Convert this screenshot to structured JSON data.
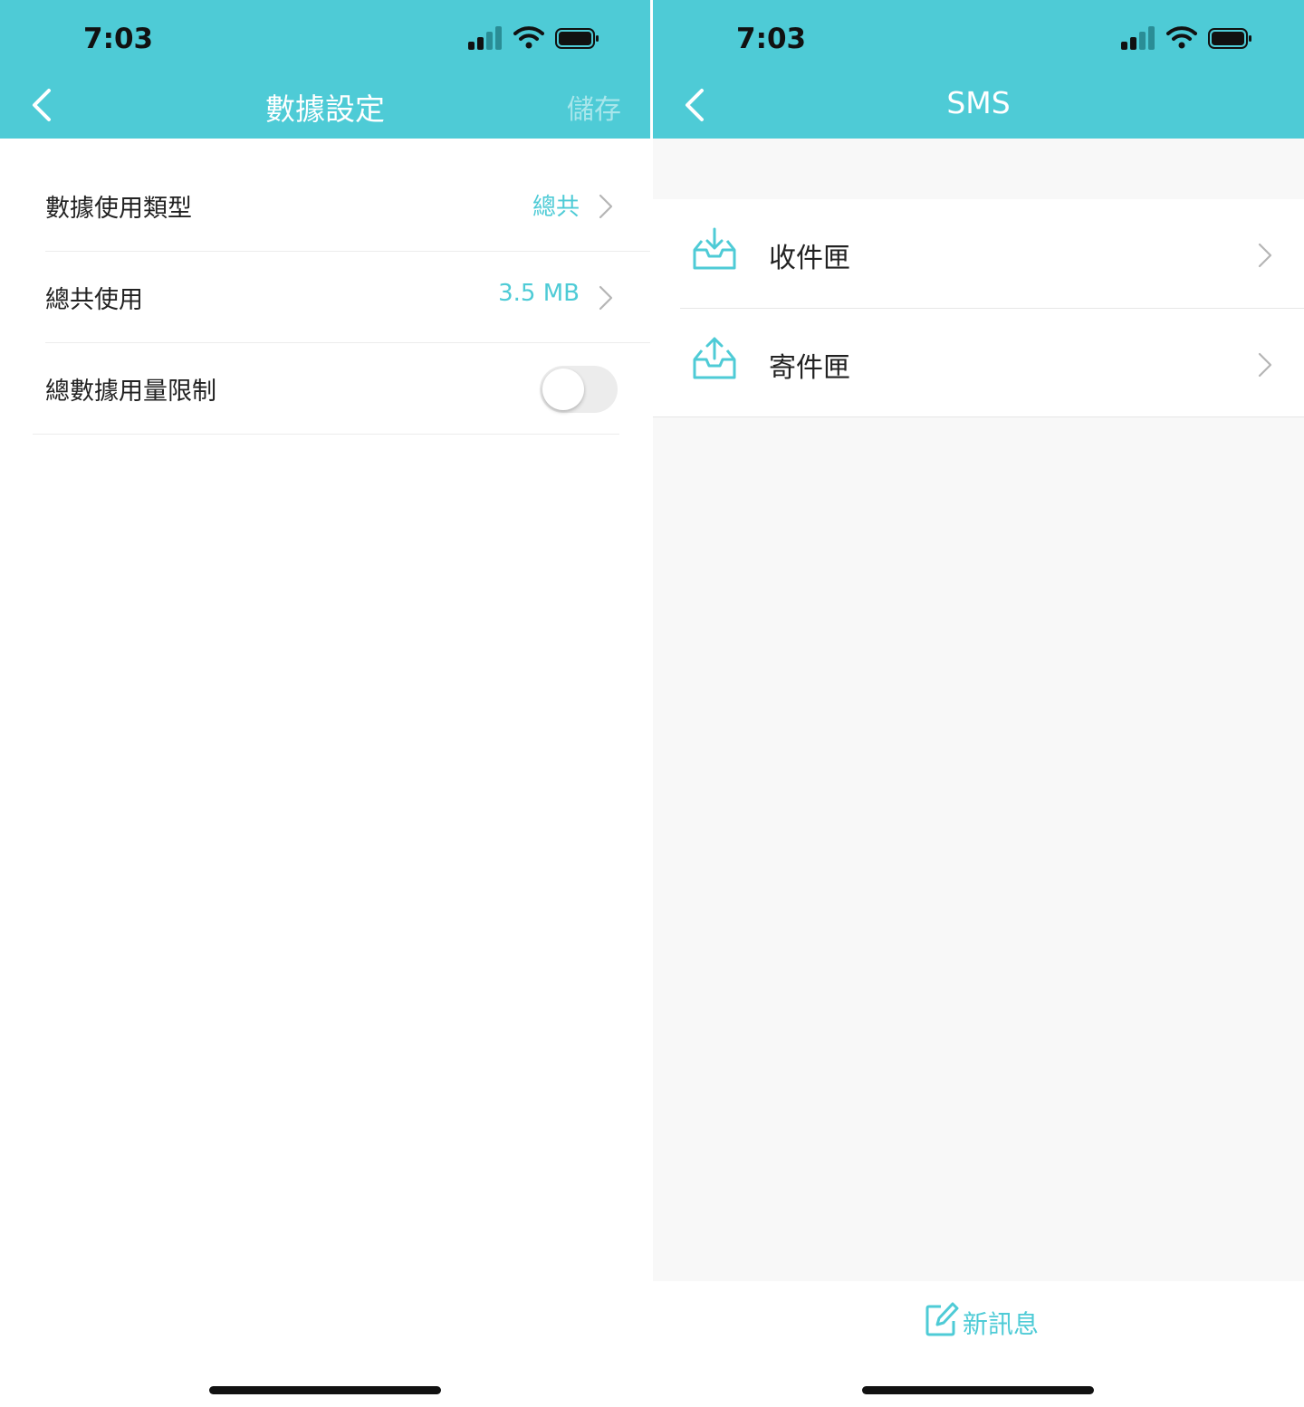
{
  "colors": {
    "accent": "#4ecbd6",
    "save_disabled": "#a8e6eb"
  },
  "left": {
    "status": {
      "time": "7:03"
    },
    "header": {
      "title": "數據設定",
      "save_label": "儲存",
      "back_icon": "chevron-left-icon"
    },
    "rows": [
      {
        "label": "數據使用類型",
        "value": "總共"
      },
      {
        "label": "總共使用",
        "value": "3.5 MB"
      },
      {
        "label": "總數據用量限制",
        "toggle_on": false
      }
    ]
  },
  "right": {
    "status": {
      "time": "7:03"
    },
    "header": {
      "title": "SMS",
      "back_icon": "chevron-left-icon"
    },
    "items": [
      {
        "label": "收件匣",
        "icon": "inbox-download-icon"
      },
      {
        "label": "寄件匣",
        "icon": "outbox-upload-icon"
      }
    ],
    "footer": {
      "compose_label": "新訊息",
      "icon": "compose-icon"
    }
  }
}
